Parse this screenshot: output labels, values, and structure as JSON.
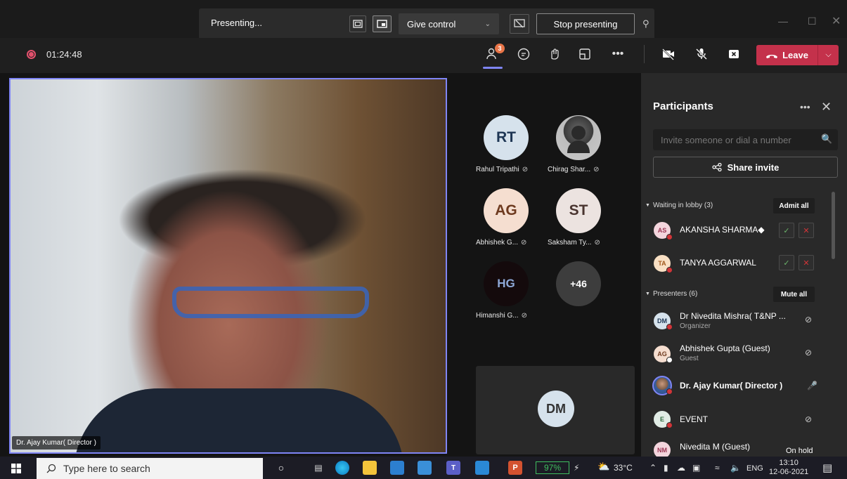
{
  "sharing_bar": {
    "status": "Presenting...",
    "give_control": "Give control",
    "stop_presenting": "Stop presenting"
  },
  "meeting_bar": {
    "timer": "01:24:48",
    "participants_badge": "3",
    "leave_label": "Leave"
  },
  "main_video": {
    "name": "Dr. Ajay Kumar( Director )"
  },
  "gallery": {
    "tiles": [
      {
        "initials": "RT",
        "name": "Rahul Tripathi"
      },
      {
        "initials": "",
        "name": "Chirag Shar..."
      },
      {
        "initials": "AG",
        "name": "Abhishek G..."
      },
      {
        "initials": "ST",
        "name": "Saksham Ty..."
      },
      {
        "initials": "HG",
        "name": "Himanshi G..."
      },
      {
        "initials": "+46",
        "name": ""
      }
    ],
    "self_initials": "DM"
  },
  "panel": {
    "title": "Participants",
    "invite_placeholder": "Invite someone or dial a number",
    "share_invite": "Share invite",
    "lobby": {
      "heading": "Waiting in lobby (3)",
      "action": "Admit all",
      "people": [
        {
          "initials": "AS",
          "name": "AKANSHA SHARMA◆"
        },
        {
          "initials": "TA",
          "name": "TANYA AGGARWAL"
        }
      ]
    },
    "presenters": {
      "heading": "Presenters (6)",
      "action": "Mute all",
      "people": [
        {
          "initials": "DM",
          "name": "Dr Nivedita Mishra( T&NP ...",
          "role": "Organizer"
        },
        {
          "initials": "AG",
          "name": "Abhishek Gupta (Guest)",
          "role": "Guest"
        },
        {
          "initials": "",
          "name": "Dr. Ajay Kumar( Director )",
          "role": ""
        },
        {
          "initials": "E",
          "name": "EVENT",
          "role": ""
        },
        {
          "initials": "NM",
          "name": "Nivedita M (Guest)",
          "role": "Guest",
          "status": "On hold"
        }
      ]
    }
  },
  "taskbar": {
    "search_placeholder": "Type here to search",
    "battery": "97%",
    "temperature": "33°C",
    "language": "ENG",
    "time": "13:10",
    "date": "12-06-2021"
  },
  "colors": {
    "accent": "#7f85f5",
    "leave": "#c4314b",
    "badge": "#e97548",
    "battery": "#3fbf5f"
  }
}
